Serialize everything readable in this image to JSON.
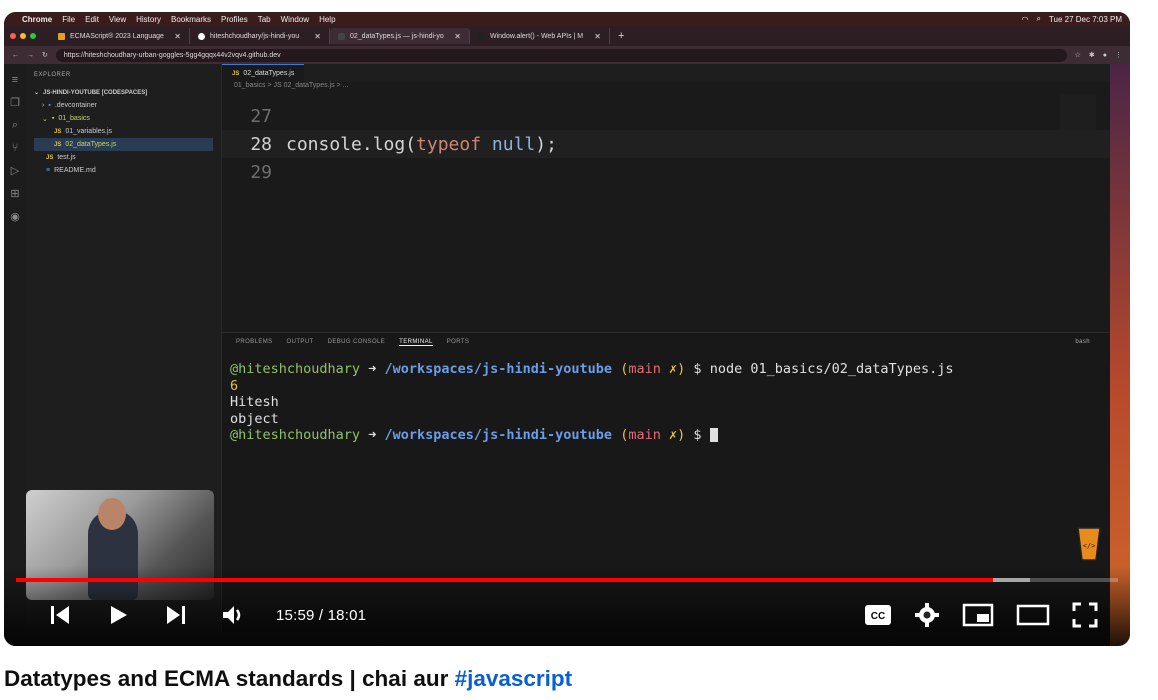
{
  "mac_menu": {
    "items": [
      "Chrome",
      "File",
      "Edit",
      "View",
      "History",
      "Bookmarks",
      "Profiles",
      "Tab",
      "Window",
      "Help"
    ],
    "clock": "Tue 27 Dec 7:03 PM"
  },
  "browser": {
    "tabs": [
      "ECMAScript® 2023 Language",
      "hiteshchoudhary/js-hindi-you",
      "02_dataTypes.js — js-hindi-yo",
      "Window.alert() - Web APIs | M"
    ],
    "url": "https://hiteshchoudhary-urban-goggles-5gg4gqqx44v2vqv4.github.dev"
  },
  "explorer": {
    "header": "EXPLORER",
    "project": "JS-HINDI-YOUTUBE [CODESPACES]",
    "items": [
      ".devcontainer",
      "01_basics",
      "01_variables.js",
      "02_dataTypes.js",
      "test.js",
      "README.md"
    ]
  },
  "editor": {
    "tab": "02_dataTypes.js",
    "breadcrumb": "01_basics > JS 02_dataTypes.js > ...",
    "lines": [
      {
        "num": "27",
        "code": ""
      },
      {
        "num": "28",
        "fn": "console.log(",
        "kw": "typeof",
        "sp": " ",
        "nl": "null",
        "end": ");"
      },
      {
        "num": "29",
        "code": ""
      }
    ]
  },
  "panel": {
    "tabs": [
      "PROBLEMS",
      "OUTPUT",
      "DEBUG CONSOLE",
      "TERMINAL",
      "PORTS"
    ],
    "shell": "bash"
  },
  "terminal": {
    "user": "@hiteshchoudhary",
    "arrow": "➜",
    "path": "/workspaces/js-hindi-youtube",
    "branch_open": "(",
    "branch": "main",
    "dirty": "✗",
    "branch_close": ")",
    "prompt": "$",
    "command": "node 01_basics/02_dataTypes.js",
    "output": [
      "6",
      "Hitesh",
      "object"
    ]
  },
  "player": {
    "time": "15:59 / 18:01",
    "progress_fraction": 0.8868,
    "buffered_fraction": 0.92
  },
  "video": {
    "title_text": "Datatypes and ECMA standards | chai aur ",
    "hashtag": "#javascript"
  }
}
